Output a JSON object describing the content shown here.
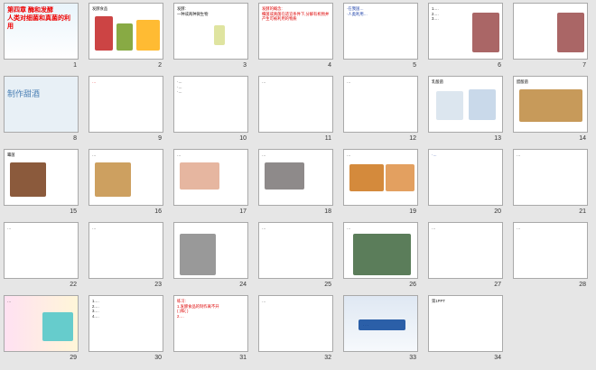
{
  "slides": [
    {
      "num": "1",
      "text": "第四章 酶和发酵\n人类对细菌和真菌的利用"
    },
    {
      "num": "2",
      "text": "发酵食品"
    },
    {
      "num": "3",
      "text": "发酵:\n一种或两种微生物"
    },
    {
      "num": "4",
      "text": "发酵的概念:\n细菌或真菌在适宜条件下,分解有机物并产生可被利用的物质"
    },
    {
      "num": "5",
      "text": "·在我国…\n·人类利用…"
    },
    {
      "num": "6",
      "text": "1.…\n2.…\n3.…"
    },
    {
      "num": "7",
      "text": ""
    },
    {
      "num": "8",
      "text": "制作甜酒"
    },
    {
      "num": "9",
      "text": "…"
    },
    {
      "num": "10",
      "text": "·…\n·…\n·…"
    },
    {
      "num": "11",
      "text": "…"
    },
    {
      "num": "12",
      "text": "…"
    },
    {
      "num": "13",
      "text": "乳酸菌"
    },
    {
      "num": "14",
      "text": "醋酸菌"
    },
    {
      "num": "15",
      "text": "霉菌"
    },
    {
      "num": "16",
      "text": "…"
    },
    {
      "num": "17",
      "text": "…"
    },
    {
      "num": "18",
      "text": "…"
    },
    {
      "num": "19",
      "text": "…"
    },
    {
      "num": "20",
      "text": "·…"
    },
    {
      "num": "21",
      "text": "…"
    },
    {
      "num": "22",
      "text": "…"
    },
    {
      "num": "23",
      "text": "…"
    },
    {
      "num": "24",
      "text": ""
    },
    {
      "num": "25",
      "text": "…"
    },
    {
      "num": "26",
      "text": "…"
    },
    {
      "num": "27",
      "text": "…"
    },
    {
      "num": "28",
      "text": "…"
    },
    {
      "num": "29",
      "text": "…"
    },
    {
      "num": "30",
      "text": "1.…\n2.…\n3.…\n4.…"
    },
    {
      "num": "31",
      "text": "练习:\n1.发酵食品的制作离不开\n( )和( )\n2.…"
    },
    {
      "num": "32",
      "text": "…"
    },
    {
      "num": "33",
      "text": "…"
    },
    {
      "num": "34",
      "text": "第1PPT"
    }
  ],
  "colors": {
    "selected_outline": "#f4a236",
    "background": "#e6e6e6"
  }
}
